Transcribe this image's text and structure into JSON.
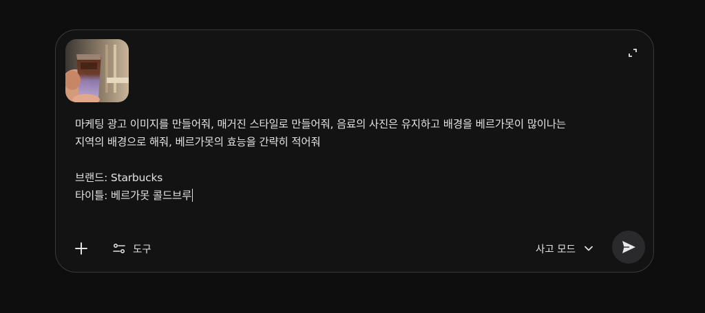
{
  "composer": {
    "attachment": {
      "kind": "image",
      "subject": "iced coffee cup held in hand"
    },
    "prompt_lines": [
      "마케팅 광고 이미지를 만들어줘, 매거진 스타일로 만들어줘, 음료의 사진은 유지하고 배경을 베르가못이 많이나는",
      "지역의 배경으로 해줘, 베르가못의 효능을 간략히 적어줘",
      "",
      "브랜드: Starbucks",
      "타이틀: 베르가못 콜드브루"
    ],
    "toolbar": {
      "add_icon": "plus-icon",
      "tools_label": "도구",
      "tools_icon": "tools-icon",
      "mode_label": "사고 모드",
      "mode_icon": "chevron-down-icon",
      "send_icon": "send-icon",
      "expand_icon": "expand-icon"
    }
  },
  "colors": {
    "background": "#0e0e0f",
    "composer_bg": "#131314",
    "border": "#3a3a3d",
    "text": "#e3e3e3",
    "send_bg": "#2a2a2c"
  }
}
